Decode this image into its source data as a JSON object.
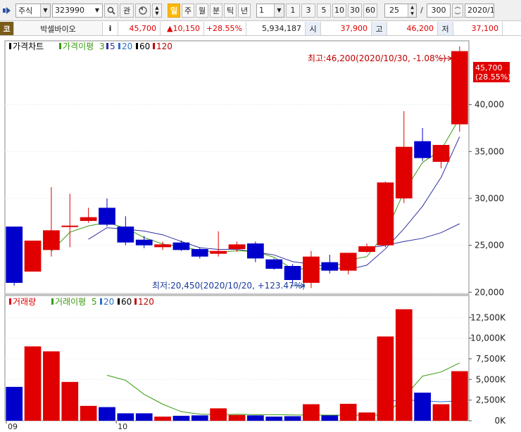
{
  "toolbar": {
    "market_select": "주식",
    "code_input": "323990",
    "btn_interest": "관",
    "periods": [
      "일",
      "주",
      "월",
      "분",
      "틱",
      "년"
    ],
    "interval_select": "1",
    "interval_buttons": [
      "1",
      "3",
      "5",
      "10",
      "30",
      "60"
    ],
    "display_count": "25",
    "slash": "/",
    "total_count": "300",
    "date_value": "2020/1"
  },
  "quote": {
    "badge": "코",
    "stock_name": "박셀바이오",
    "info_button": "i",
    "price": "45,700",
    "change": "▲10,150",
    "change_rate": "+28.55%",
    "volume": "5,934,187",
    "open_label": "시",
    "open": "37,900",
    "high_label": "고",
    "high": "46,200",
    "low_label": "저",
    "low": "37,100"
  },
  "price_legend": {
    "title": "가격차트",
    "ma_label": "가격이평",
    "ma_values": [
      "3",
      "5",
      "20",
      "60",
      "120"
    ]
  },
  "volume_legend": {
    "title": "거래량",
    "ma_label": "거래이평",
    "ma_values": [
      "5",
      "20",
      "60",
      "120"
    ]
  },
  "annotations": {
    "high_note": "최고:46,200(2020/10/30, -1.08%)",
    "low_note": "최저:20,450(2020/10/20, +123.47%)",
    "last_price": "45,700",
    "last_rate": "(28.55%)"
  },
  "colors": {
    "up": "#e00000",
    "down": "#0000cc",
    "ma3": "#3a9a10",
    "ma5": "#3030a0",
    "ma20": "#2a70c8",
    "ma60": "#000000",
    "ma120": "#c00000"
  },
  "chart_data": {
    "type": "candlestick",
    "x_labels": [
      "09",
      "10"
    ],
    "price_axis": {
      "ticks": [
        "20,000",
        "25,000",
        "30,000",
        "35,000",
        "40,000"
      ],
      "range": [
        19800,
        46800
      ]
    },
    "volume_axis": {
      "ticks": [
        "0K",
        "2,500K",
        "5,000K",
        "7,500K",
        "10,000K",
        "12,500K"
      ],
      "range": [
        0,
        13800
      ]
    },
    "candles": [
      {
        "o": 27000,
        "h": 27000,
        "l": 20700,
        "c": 21000
      },
      {
        "o": 22200,
        "h": 25500,
        "l": 22200,
        "c": 25500
      },
      {
        "o": 24500,
        "h": 31200,
        "l": 23800,
        "c": 26600
      },
      {
        "o": 27000,
        "h": 30500,
        "l": 24800,
        "c": 27100
      },
      {
        "o": 27600,
        "h": 29000,
        "l": 27400,
        "c": 28000
      },
      {
        "o": 29000,
        "h": 30000,
        "l": 27000,
        "c": 27200
      },
      {
        "o": 27000,
        "h": 28100,
        "l": 25000,
        "c": 25300
      },
      {
        "o": 25600,
        "h": 26000,
        "l": 24700,
        "c": 25000
      },
      {
        "o": 24800,
        "h": 25400,
        "l": 24500,
        "c": 25100
      },
      {
        "o": 25300,
        "h": 25500,
        "l": 24400,
        "c": 24500
      },
      {
        "o": 24600,
        "h": 24800,
        "l": 23600,
        "c": 23800
      },
      {
        "o": 24100,
        "h": 26500,
        "l": 23800,
        "c": 24400
      },
      {
        "o": 24600,
        "h": 25400,
        "l": 24300,
        "c": 25100
      },
      {
        "o": 25200,
        "h": 25400,
        "l": 23200,
        "c": 23600
      },
      {
        "o": 23500,
        "h": 23600,
        "l": 22400,
        "c": 22500
      },
      {
        "o": 22800,
        "h": 23000,
        "l": 21000,
        "c": 21300
      },
      {
        "o": 21000,
        "h": 24400,
        "l": 20450,
        "c": 23800
      },
      {
        "o": 23200,
        "h": 24000,
        "l": 22000,
        "c": 22300
      },
      {
        "o": 22300,
        "h": 24200,
        "l": 21900,
        "c": 24200
      },
      {
        "o": 24300,
        "h": 25200,
        "l": 24200,
        "c": 24900
      },
      {
        "o": 25000,
        "h": 31800,
        "l": 24800,
        "c": 31700
      },
      {
        "o": 30000,
        "h": 39300,
        "l": 29500,
        "c": 35500
      },
      {
        "o": 36100,
        "h": 37500,
        "l": 34000,
        "c": 34300
      },
      {
        "o": 33900,
        "h": 35700,
        "l": 33200,
        "c": 35700
      },
      {
        "o": 37900,
        "h": 46200,
        "l": 37100,
        "c": 45700
      }
    ],
    "price_ma": {
      "ma3": [
        null,
        null,
        24366,
        26400,
        27066,
        27433,
        26833,
        25833,
        25133,
        24866,
        24466,
        24233,
        24433,
        24333,
        23733,
        22466,
        22533,
        22466,
        23433,
        23800,
        26266,
        30700,
        33833,
        35166,
        38566
      ],
      "ma5": [
        null,
        null,
        null,
        null,
        25640,
        26880,
        26720,
        26520,
        26120,
        25420,
        24740,
        24560,
        24580,
        24280,
        23980,
        23260,
        23000,
        22700,
        22420,
        22880,
        24620,
        26760,
        29160,
        32240,
        36580
      ],
      "ma20": [
        null,
        null,
        null,
        null,
        null,
        null,
        null,
        null,
        null,
        null,
        null,
        null,
        null,
        null,
        null,
        null,
        null,
        null,
        null,
        24700,
        25000,
        25400,
        25750,
        26350,
        27300
      ]
    },
    "volumes": [
      4100,
      9000,
      8400,
      4700,
      1800,
      1650,
      900,
      900,
      500,
      600,
      650,
      1500,
      700,
      650,
      500,
      550,
      2000,
      650,
      2050,
      1000,
      10200,
      13500,
      3400,
      2000,
      6000
    ],
    "volume_ma": {
      "ma5": [
        null,
        null,
        null,
        null,
        null,
        5500,
        4900,
        3200,
        2000,
        1100,
        800,
        720,
        780,
        730,
        730,
        700,
        680,
        680,
        680,
        680,
        700,
        2800,
        5400,
        5900,
        7000
      ],
      "ma20": [
        null,
        null,
        null,
        null,
        null,
        null,
        null,
        null,
        null,
        null,
        null,
        null,
        null,
        null,
        null,
        null,
        null,
        null,
        null,
        null,
        2300,
        2550,
        2400,
        2300,
        2400
      ]
    }
  }
}
